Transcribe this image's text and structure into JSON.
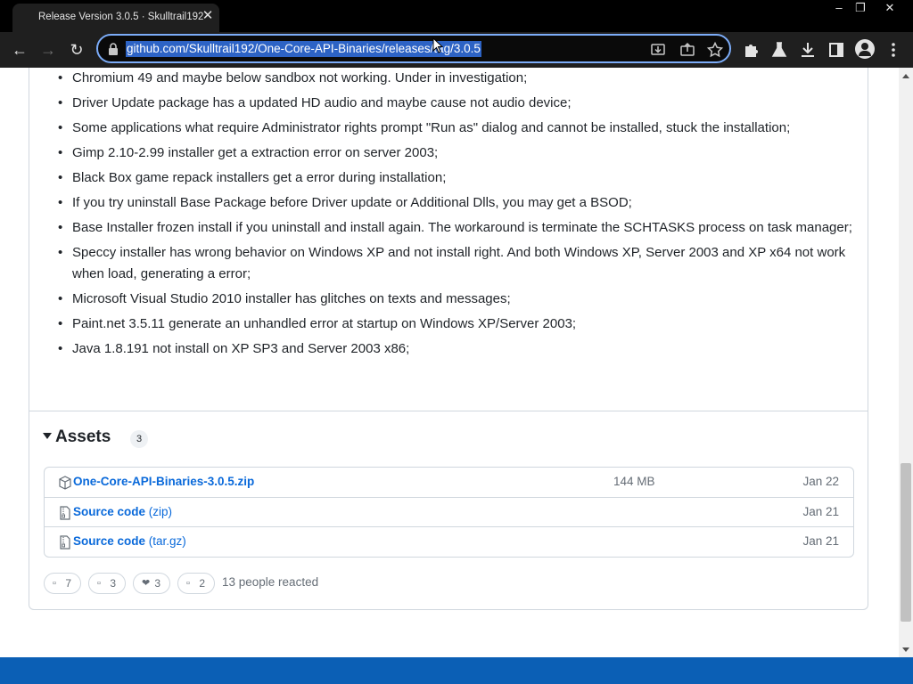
{
  "browser": {
    "tab_title": "Release Version 3.0.5 · Skulltrail192",
    "tab_close": "✕",
    "window_controls": {
      "minimize": "–",
      "restore": "❐",
      "close": "✕"
    },
    "nav": {
      "back": "←",
      "forward": "→",
      "reload": "↻"
    },
    "url": "github.com/Skulltrail192/One-Core-API-Binaries/releases/tag/3.0.5",
    "icons": [
      "lock-icon",
      "install-icon",
      "share-icon",
      "star-icon",
      "extensions-icon",
      "labs-icon",
      "download-icon",
      "side-panel-icon",
      "profile-icon",
      "menu-icon"
    ],
    "accent": "#7cacf8",
    "selection_color": "#2d63c5"
  },
  "release": {
    "known_issues": [
      "Chromium 49 and maybe below sandbox not working. Under in investigation;",
      "Driver Update package has a updated HD audio and maybe cause not audio device;",
      "Some applications what require Administrator rights prompt \"Run as\" dialog and cannot be installed, stuck the installation;",
      "Gimp 2.10-2.99 installer get a extraction error on server 2003;",
      "Black Box game repack installers get a error during installation;",
      "If you try uninstall Base Package before Driver update or Additional Dlls, you may get a BSOD;",
      "Base Installer frozen install if you uninstall and install again. The workaround is terminate the SCHTASKS process on task manager;",
      "Speccy installer has wrong behavior on Windows XP and not install right. And both Windows XP, Server 2003 and XP x64 not work when load, generating a error;",
      "Microsoft Visual Studio 2010 installer has glitches on texts and messages;",
      "Paint.net 3.5.11 generate an unhandled error at startup on Windows XP/Server 2003;",
      "Java 1.8.191 not install on XP SP3 and Server 2003 x86;"
    ]
  },
  "assets": {
    "title": "Assets",
    "count": "3",
    "items": [
      {
        "name": "One-Core-API-Binaries-3.0.5.zip",
        "suffix": "",
        "size": "144 MB",
        "date": "Jan 22",
        "icon": "package-icon"
      },
      {
        "name": "Source code",
        "suffix": " (zip)",
        "size": "",
        "date": "Jan 21",
        "icon": "file-zip-icon"
      },
      {
        "name": "Source code",
        "suffix": " (tar.gz)",
        "size": "",
        "date": "Jan 21",
        "icon": "file-zip-icon"
      }
    ],
    "link_color": "#0969da"
  },
  "reactions": {
    "items": [
      {
        "emoji": "▫",
        "count": "7"
      },
      {
        "emoji": "▫",
        "count": "3"
      },
      {
        "emoji": "❤",
        "count": "3"
      },
      {
        "emoji": "▫",
        "count": "2"
      }
    ],
    "summary": "13 people reacted"
  }
}
